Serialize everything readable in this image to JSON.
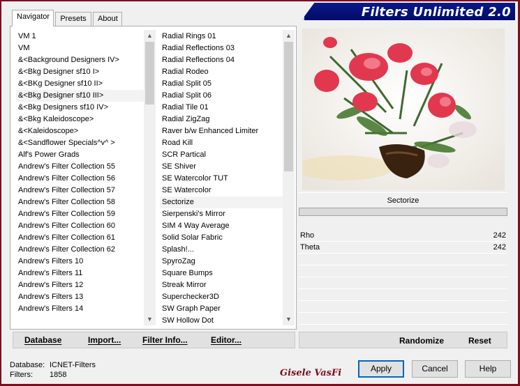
{
  "title": "Filters Unlimited 2.0",
  "tabs": [
    {
      "label": "Navigator"
    },
    {
      "label": "Presets"
    },
    {
      "label": "About"
    }
  ],
  "categories": [
    " VM 1",
    " VM",
    "&<Background Designers IV>",
    "&<Bkg Designer sf10 I>",
    "&<BKg Designer sf10 II>",
    "&<Bkg Designer sf10 III>",
    "&<Bkg Designers sf10 IV>",
    "&<Bkg Kaleidoscope>",
    "&<Kaleidoscope>",
    "&<Sandflower Specials^v^ >",
    "Alf's Power Grads",
    "Andrew's Filter Collection 55",
    "Andrew's Filter Collection 56",
    "Andrew's Filter Collection 57",
    "Andrew's Filter Collection 58",
    "Andrew's Filter Collection 59",
    "Andrew's Filter Collection 60",
    "Andrew's Filter Collection 61",
    "Andrew's Filter Collection 62",
    "Andrew's Filters 10",
    "Andrew's Filters 11",
    "Andrew's Filters 12",
    "Andrew's Filters 13",
    "Andrew's Filters 14"
  ],
  "selected_category": "&<Bkg Designer sf10 III>",
  "filters": [
    "Radial  Rings 01",
    "Radial Reflections 03",
    "Radial Reflections 04",
    "Radial Rodeo",
    "Radial Split 05",
    "Radial Split 06",
    "Radial Tile 01",
    "Radial ZigZag",
    "Raver b/w Enhanced Limiter",
    "Road Kill",
    "SCR  Partical",
    "SE Shiver",
    "SE Watercolor TUT",
    "SE Watercolor",
    "Sectorize",
    "Sierpenski's Mirror",
    "SIM 4 Way Average",
    "Solid Solar Fabric",
    "Splash!...",
    "SpyroZag",
    "Square Bumps",
    "Streak Mirror",
    "Superchecker3D",
    "SW Graph Paper",
    "SW Hollow Dot"
  ],
  "selected_filter": "Sectorize",
  "left_buttons": {
    "database": "Database",
    "import": "Import...",
    "filter_info": "Filter Info...",
    "editor": "Editor..."
  },
  "preview": {
    "filter_name": "Sectorize"
  },
  "params": [
    {
      "name": "Rho",
      "value": "242"
    },
    {
      "name": "Theta",
      "value": "242"
    }
  ],
  "right_buttons": {
    "randomize": "Randomize",
    "reset": "Reset"
  },
  "footer": {
    "database_label": "Database:",
    "database_value": "ICNET-Filters",
    "filters_label": "Filters:",
    "filters_value": "1858",
    "signature": "Gisele VasFi"
  },
  "dialog_buttons": {
    "apply": "Apply",
    "cancel": "Cancel",
    "help": "Help"
  },
  "colors": {
    "banner": "#020a6a",
    "frame": "#7a0f1e",
    "signature": "#7a0f1e",
    "apply_border": "#0a64b4"
  }
}
